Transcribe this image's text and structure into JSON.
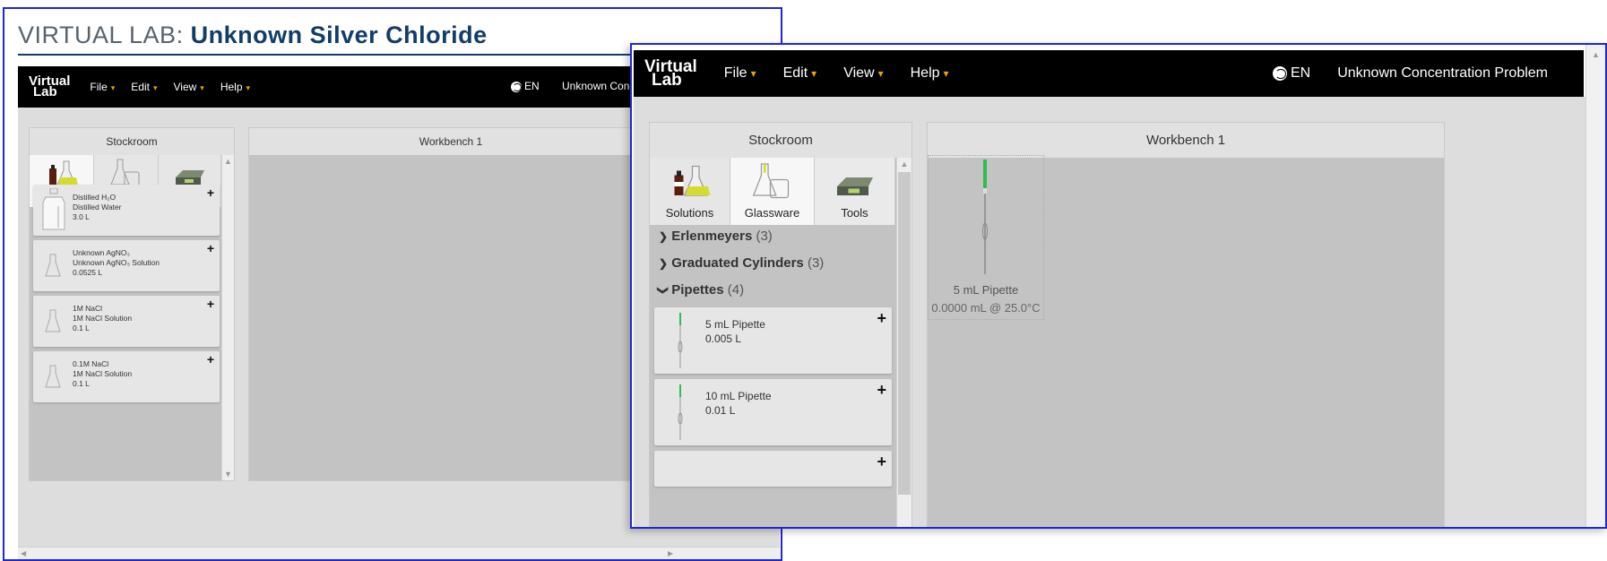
{
  "page": {
    "title_prefix": "VIRTUAL LAB: ",
    "title_main": "Unknown Silver Chloride"
  },
  "navbar": {
    "brand_top": "Virtual",
    "brand_bottom": "Lab",
    "menus": [
      "File",
      "Edit",
      "View",
      "Help"
    ],
    "language": "EN",
    "problem_title": "Unknown Concentration Problem",
    "problem_title_truncated": "Unknown Conc"
  },
  "stockroom": {
    "title": "Stockroom",
    "tabs": [
      "Solutions",
      "Glassware",
      "Tools"
    ],
    "solutions": [
      {
        "line1": "Distilled H₂O",
        "line2": "Distilled Water",
        "line3": "3.0 L"
      },
      {
        "line1": "Unknown AgNO₃",
        "line2": "Unknown AgNO₃ Solution",
        "line3": "0.0525 L"
      },
      {
        "line1": "1M NaCl",
        "line2": "1M NaCl Solution",
        "line3": "0.1 L"
      },
      {
        "line1": "0.1M NaCl",
        "line2": "1M NaCl Solution",
        "line3": "0.1 L"
      }
    ],
    "glassware_categories": [
      {
        "name": "Erlenmeyers",
        "count": "(3)",
        "expanded": false
      },
      {
        "name": "Graduated Cylinders",
        "count": "(3)",
        "expanded": false
      },
      {
        "name": "Pipettes",
        "count": "(4)",
        "expanded": true
      }
    ],
    "pipettes": [
      {
        "name": "5 mL Pipette",
        "volume": "0.005 L"
      },
      {
        "name": "10 mL Pipette",
        "volume": "0.01 L"
      }
    ]
  },
  "workbench": {
    "title": "Workbench 1",
    "item_name": "5 mL Pipette",
    "item_status": "0.0000 mL @ 25.0°C"
  },
  "icons": {
    "plus": "+",
    "chevron_right": "❯",
    "chevron_down": "❯",
    "caret": "▾",
    "scroll_up": "▲",
    "scroll_down": "▼",
    "scroll_left": "◀",
    "scroll_right": "▶"
  },
  "colors": {
    "navbar": "#000000",
    "menu_caret": "#e0a800",
    "border_highlight": "#1f26d6",
    "title_blue": "#123d6a",
    "pipette_green": "#2ebd4e"
  }
}
